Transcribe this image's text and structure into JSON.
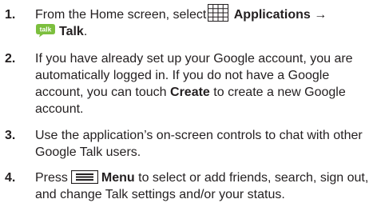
{
  "steps": [
    {
      "number": "1.",
      "line1_prefix": "From the Home screen, select",
      "applications_label": "Applications",
      "arrow": "→",
      "talk_label": "Talk",
      "period": "."
    },
    {
      "number": "2.",
      "lines": [
        "If you have already set up your Google account, you are",
        "automatically logged in. If you do not have a Google"
      ],
      "line3_prefix": "account, you can touch",
      "create_label": "Create",
      "line3_suffix": "to create a new Google",
      "line4": "account."
    },
    {
      "number": "3.",
      "lines": [
        "Use the application’s on-screen controls to chat with other",
        "Google Talk users."
      ]
    },
    {
      "number": "4.",
      "line1_prefix": "Press",
      "menu_label": "Menu",
      "line1_suffix": "to select or add friends, search, sign out,",
      "line2": "and change Talk settings and/or your status."
    }
  ],
  "icons": {
    "applications": "applications-grid-icon",
    "talk": "talk-icon",
    "menu": "menu-key-icon"
  },
  "colors": {
    "text": "#231f20",
    "talk_bubble": "#7cbf3e"
  }
}
